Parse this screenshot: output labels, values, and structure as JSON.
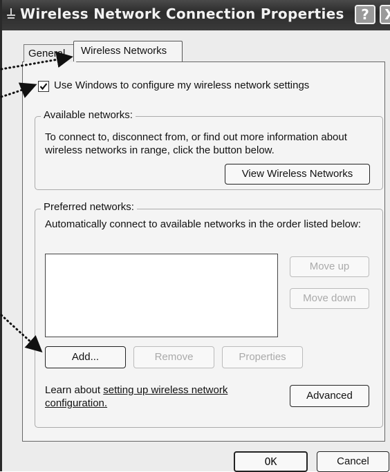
{
  "window": {
    "title": "Wireless Network Connection Properties",
    "help_button": "?",
    "close_button": "X"
  },
  "tabs": [
    {
      "label": "General",
      "selected": false
    },
    {
      "label": "Wireless Networks",
      "selected": true
    }
  ],
  "use_windows_checkbox": {
    "label": "Use Windows to configure my wireless network settings",
    "checked": true
  },
  "available_networks": {
    "title": "Available networks:",
    "description": "To connect to, disconnect from, or find out more information about wireless networks in range, click the button below.",
    "view_button": "View Wireless Networks"
  },
  "preferred_networks": {
    "title": "Preferred networks:",
    "description": "Automatically connect to available networks in the order listed below:",
    "list_items": [],
    "move_up_button": "Move up",
    "move_down_button": "Move down",
    "add_button": "Add...",
    "remove_button": "Remove",
    "properties_button": "Properties"
  },
  "learn": {
    "prefix": "Learn about ",
    "link": "setting up wireless network configuration.",
    "advanced_button": "Advanced"
  },
  "footer": {
    "ok_button": "OK",
    "cancel_button": "Cancel"
  }
}
